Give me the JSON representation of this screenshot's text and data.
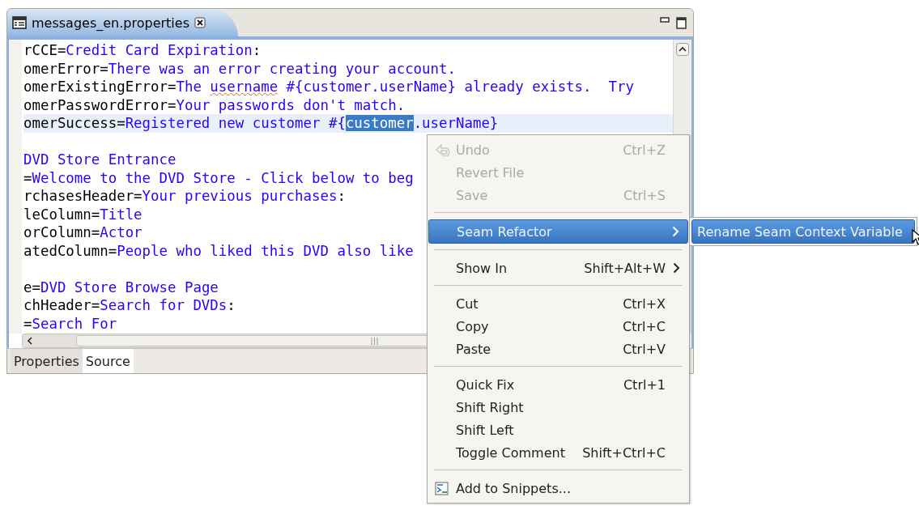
{
  "editor": {
    "tab": {
      "title": "messages_en.properties"
    },
    "lines": [
      {
        "current": false,
        "segments": [
          {
            "kind": "key",
            "text": "rCCE="
          },
          {
            "kind": "value",
            "text": "Credit Card Expiration"
          },
          {
            "kind": "key",
            "text": ":"
          }
        ]
      },
      {
        "current": false,
        "segments": [
          {
            "kind": "key",
            "text": "omerError="
          },
          {
            "kind": "value",
            "text": "There was an error creating your account."
          }
        ]
      },
      {
        "current": false,
        "segments": [
          {
            "kind": "key",
            "text": "omerExistingError="
          },
          {
            "kind": "value",
            "text": "The "
          },
          {
            "kind": "misspelled",
            "text": "username"
          },
          {
            "kind": "value",
            "text": " #{customer.userName} already exists.  Try"
          }
        ]
      },
      {
        "current": false,
        "segments": [
          {
            "kind": "key",
            "text": "omerPasswordError="
          },
          {
            "kind": "value",
            "text": "Your passwords don't match."
          }
        ]
      },
      {
        "current": true,
        "segments": [
          {
            "kind": "key",
            "text": "omerSuccess="
          },
          {
            "kind": "value",
            "text": "Registered new customer #{"
          },
          {
            "kind": "selected",
            "text": "customer"
          },
          {
            "kind": "value",
            "text": ".userName}"
          }
        ]
      },
      {
        "kind": "blank"
      },
      {
        "current": false,
        "segments": [
          {
            "kind": "value",
            "text": "DVD Store Entrance"
          }
        ]
      },
      {
        "current": false,
        "segments": [
          {
            "kind": "key",
            "text": "="
          },
          {
            "kind": "value",
            "text": "Welcome to the DVD Store - Click below to beg"
          }
        ]
      },
      {
        "current": false,
        "segments": [
          {
            "kind": "key",
            "text": "rchasesHeader="
          },
          {
            "kind": "value",
            "text": "Your previous purchases"
          },
          {
            "kind": "key",
            "text": ":"
          }
        ]
      },
      {
        "current": false,
        "segments": [
          {
            "kind": "key",
            "text": "leColumn="
          },
          {
            "kind": "value",
            "text": "Title"
          }
        ]
      },
      {
        "current": false,
        "segments": [
          {
            "kind": "key",
            "text": "orColumn="
          },
          {
            "kind": "value",
            "text": "Actor"
          }
        ]
      },
      {
        "current": false,
        "segments": [
          {
            "kind": "key",
            "text": "atedColumn="
          },
          {
            "kind": "value",
            "text": "People who liked this DVD also like"
          }
        ]
      },
      {
        "kind": "blank"
      },
      {
        "current": false,
        "segments": [
          {
            "kind": "key",
            "text": "e="
          },
          {
            "kind": "value",
            "text": "DVD Store Browse Page"
          }
        ]
      },
      {
        "current": false,
        "segments": [
          {
            "kind": "key",
            "text": "chHeader="
          },
          {
            "kind": "value",
            "text": "Search for DVDs"
          },
          {
            "kind": "key",
            "text": ":"
          }
        ]
      },
      {
        "current": false,
        "segments": [
          {
            "kind": "key",
            "text": "="
          },
          {
            "kind": "value",
            "text": "Search For"
          }
        ]
      }
    ],
    "bottom_tabs": [
      {
        "label": "Properties",
        "selected": false
      },
      {
        "label": "Source",
        "selected": true
      }
    ]
  },
  "context_menu": {
    "items": [
      {
        "kind": "item",
        "label": "Undo",
        "shortcut": "Ctrl+Z",
        "disabled": true,
        "selected": false,
        "has_submenu": false
      },
      {
        "kind": "item",
        "label": "Revert File",
        "disabled": true,
        "selected": false,
        "has_submenu": false
      },
      {
        "kind": "item",
        "label": "Save",
        "shortcut": "Ctrl+S",
        "disabled": true,
        "selected": false,
        "has_submenu": false
      },
      {
        "kind": "separator"
      },
      {
        "kind": "item",
        "label": "Seam Refactor",
        "disabled": false,
        "selected": true,
        "has_submenu": true,
        "submenu": {
          "items": [
            {
              "label": "Rename Seam Context Variable",
              "selected": true
            }
          ]
        }
      },
      {
        "kind": "separator"
      },
      {
        "kind": "item",
        "label": "Show In",
        "shortcut": "Shift+Alt+W",
        "disabled": false,
        "selected": false,
        "has_submenu": true
      },
      {
        "kind": "separator"
      },
      {
        "kind": "item",
        "label": "Cut",
        "shortcut": "Ctrl+X",
        "disabled": false,
        "selected": false,
        "has_submenu": false
      },
      {
        "kind": "item",
        "label": "Copy",
        "shortcut": "Ctrl+C",
        "disabled": false,
        "selected": false,
        "has_submenu": false
      },
      {
        "kind": "item",
        "label": "Paste",
        "shortcut": "Ctrl+V",
        "disabled": false,
        "selected": false,
        "has_submenu": false
      },
      {
        "kind": "separator"
      },
      {
        "kind": "item",
        "label": "Quick Fix",
        "shortcut": "Ctrl+1",
        "disabled": false,
        "selected": false,
        "has_submenu": false
      },
      {
        "kind": "item",
        "label": "Shift Right",
        "disabled": false,
        "selected": false,
        "has_submenu": false
      },
      {
        "kind": "item",
        "label": "Shift Left",
        "disabled": false,
        "selected": false,
        "has_submenu": false
      },
      {
        "kind": "item",
        "label": "Toggle Comment",
        "shortcut": "Shift+Ctrl+C",
        "disabled": false,
        "selected": false,
        "has_submenu": false
      },
      {
        "kind": "separator"
      },
      {
        "kind": "item",
        "label": "Add to Snippets...",
        "disabled": false,
        "selected": false,
        "has_submenu": false
      }
    ]
  }
}
